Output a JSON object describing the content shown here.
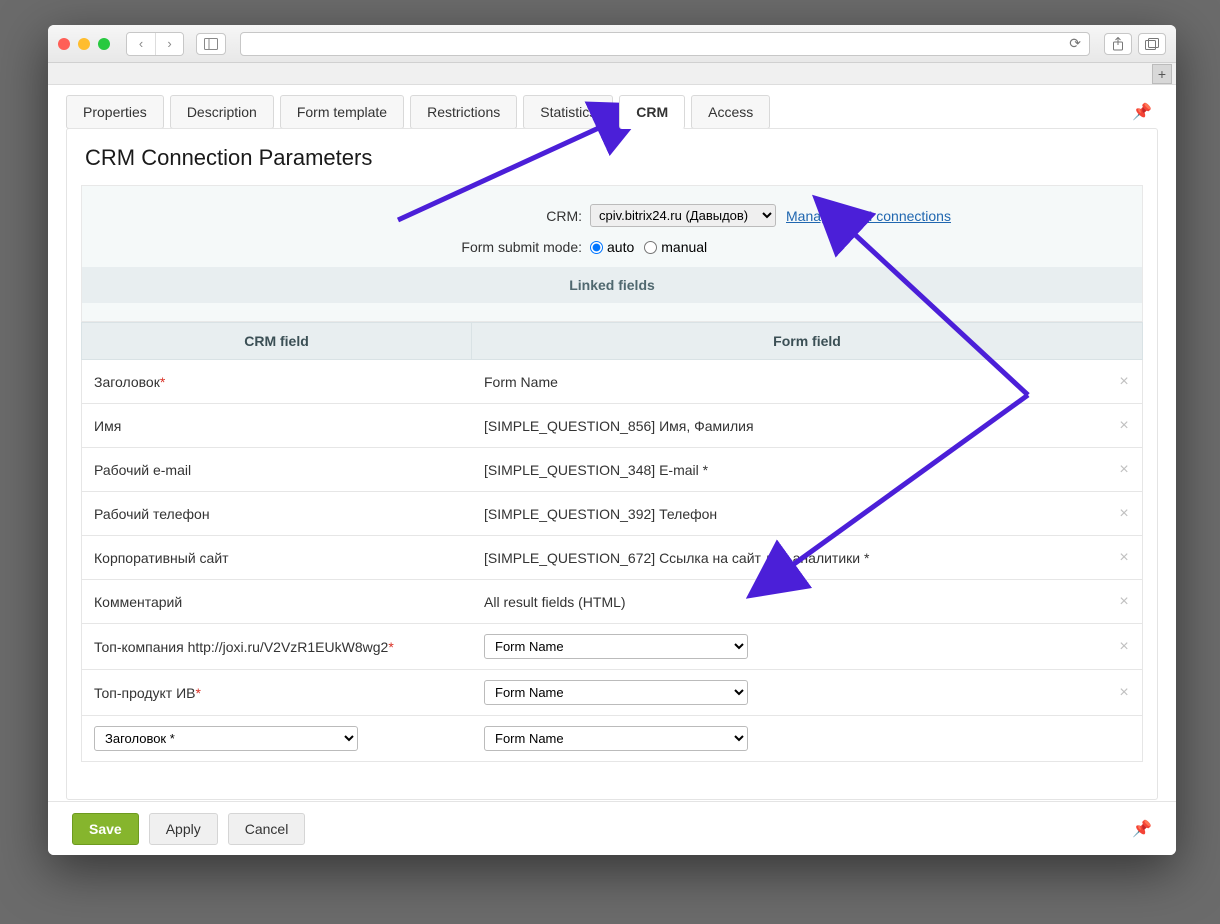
{
  "tabs": {
    "properties": "Properties",
    "description": "Description",
    "form_template": "Form template",
    "restrictions": "Restrictions",
    "statistics": "Statistics",
    "crm": "CRM",
    "access": "Access"
  },
  "page_title": "CRM Connection Parameters",
  "crm_row": {
    "label": "CRM:",
    "selected": "cpiv.bitrix24.ru (Давыдов)",
    "manage_link": "Manage CRM connections"
  },
  "submit_row": {
    "label": "Form submit mode:",
    "auto": "auto",
    "manual": "manual",
    "selected": "auto"
  },
  "section_linked": "Linked fields",
  "grid_headers": {
    "crm": "CRM field",
    "form": "Form field"
  },
  "rows": [
    {
      "crm": "Заголовок",
      "required": true,
      "form": "Form Name",
      "type": "text"
    },
    {
      "crm": "Имя",
      "required": false,
      "form": "[SIMPLE_QUESTION_856] Имя, Фамилия",
      "type": "text"
    },
    {
      "crm": "Рабочий e-mail",
      "required": false,
      "form": "[SIMPLE_QUESTION_348] E-mail *",
      "type": "text"
    },
    {
      "crm": "Рабочий телефон",
      "required": false,
      "form": "[SIMPLE_QUESTION_392] Телефон",
      "type": "text"
    },
    {
      "crm": "Корпоративный сайт",
      "required": false,
      "form": "[SIMPLE_QUESTION_672] Ссылка на сайт для аналитики *",
      "type": "text"
    },
    {
      "crm": "Комментарий",
      "required": false,
      "form": "All result fields (HTML)",
      "type": "text"
    },
    {
      "crm": "Топ-компания http://joxi.ru/V2VzR1EUkW8wg2",
      "required": true,
      "form": "Form Name",
      "type": "select"
    },
    {
      "crm": "Топ-продукт ИВ",
      "required": true,
      "form": "Form Name",
      "type": "select"
    }
  ],
  "new_row": {
    "crm_select": "Заголовок *",
    "form_select": "Form Name"
  },
  "footer": {
    "save": "Save",
    "apply": "Apply",
    "cancel": "Cancel"
  }
}
